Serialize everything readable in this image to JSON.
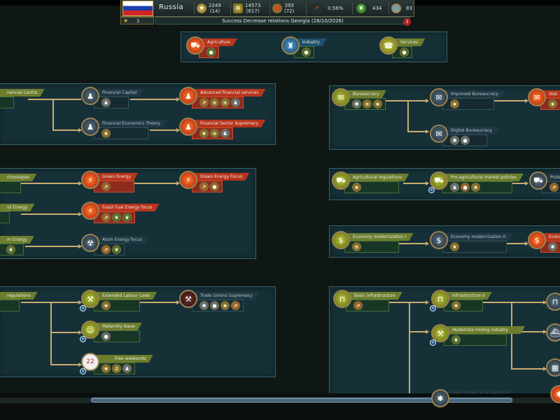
{
  "topbar": {
    "country": "Russia",
    "resources": [
      {
        "icon": "star-icon",
        "value": "2249",
        "sub": "(14)"
      },
      {
        "icon": "money-icon",
        "value": "14573",
        "sub": "(617)"
      },
      {
        "icon": "food-icon",
        "value": "393",
        "sub": "(72)"
      },
      {
        "icon": "growth-icon",
        "value": "0.56%",
        "sub": ""
      },
      {
        "icon": "leaf-icon",
        "value": "434",
        "sub": ""
      },
      {
        "icon": "population-icon",
        "value": "83",
        "sub": ""
      }
    ],
    "level": "1",
    "notification": "Success Decrease relations Georgia (28/10/2026)",
    "notification_count": "3"
  },
  "categories": [
    {
      "label": "Agriculture"
    },
    {
      "label": "Industry"
    },
    {
      "label": "Services"
    }
  ],
  "finance": {
    "n1": "nancial Centre",
    "n2": "Financial Capital",
    "n3": "Advanced financial services",
    "n4": "Financial Economics Theory",
    "n5": "Financial Sector Supremacy"
  },
  "energy": {
    "n1": "chnologies",
    "n2": "Green Energy",
    "n3": "Green Energy Focus",
    "n4": "sil Energy",
    "n5": "Fossil Fuel Energy focus",
    "n6": "m Energy",
    "n7": "Atom Energy focus"
  },
  "labour": {
    "n1": "regulations",
    "n2": "Extended Labour Laws",
    "n3": "Trade Unions Supremacy",
    "n4": "Maternity leave",
    "n5": "Free weekends",
    "calendar_day": "22"
  },
  "bureaucracy": {
    "n1": "Bureaucracy",
    "n2": "Improved Bureaucracy",
    "n3": "Stat",
    "n4": "Digital Bureaucracy"
  },
  "agri_reg": {
    "n1": "Agricultural regulations",
    "n2": "Pro-agricultural market policies",
    "n3": "Protecti"
  },
  "econ": {
    "n1": "Economy modernization I",
    "n2": "Economy modernization II",
    "n3": "Econom"
  },
  "infra": {
    "n1": "Basic infrastructure",
    "n2": "Infrastructure II",
    "n3": "Modernize mining industry",
    "n4": "Advanced technical Upgr"
  },
  "colors": {
    "researched": "#6c7d2e",
    "available": "#b8341c",
    "locked": "#203842",
    "line": "#c9ac6e"
  }
}
